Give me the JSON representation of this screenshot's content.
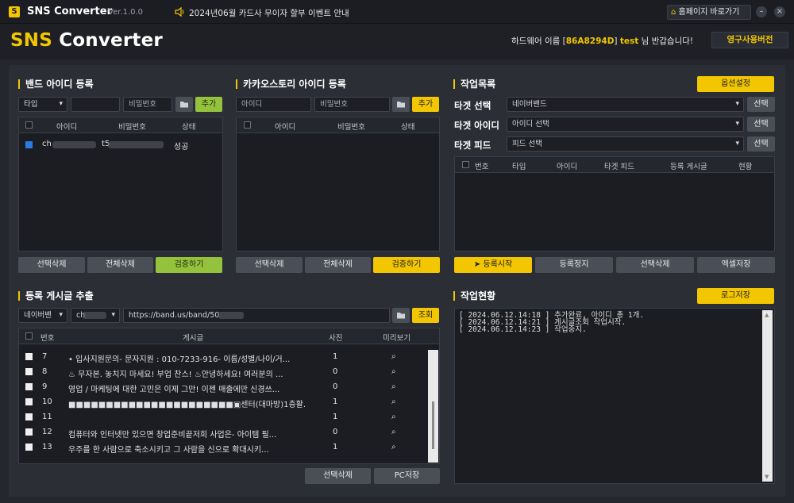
{
  "titlebar": {
    "logo_letter": "S",
    "app_name": "SNS Converter",
    "version": "Ver.1.0.0",
    "notice": "2024년06월 카드사 무이자 할부 이벤트 안내",
    "home_button": "홈페이지 바로가기",
    "minimize": "–",
    "close": "×"
  },
  "header": {
    "logo_sns": "SNS",
    "logo_converter": "Converter",
    "hw_prefix": "하드웨어 이름 [",
    "hw_id": "86A8294D",
    "hw_mid": "] ",
    "user": "test",
    "hw_suffix": " 님 반갑습니다!",
    "license_button": "영구사용버전"
  },
  "band": {
    "title": "밴드 아이디 등록",
    "type_select": "타입",
    "id_placeholder": "",
    "pw_placeholder": "비밀번호",
    "add_button": "추가",
    "columns": [
      "아이디",
      "비밀번호",
      "상태"
    ],
    "rows": [
      {
        "id": "ch",
        "pw": "t5",
        "status": "성공"
      }
    ],
    "delete_selected": "선택삭제",
    "delete_all": "전체삭제",
    "verify": "검증하기"
  },
  "kakao": {
    "title": "카카오스토리 아이디 등록",
    "id_placeholder": "아이디",
    "pw_placeholder": "비밀번호",
    "add_button": "추가",
    "columns": [
      "아이디",
      "비밀번호",
      "상태"
    ],
    "delete_selected": "선택삭제",
    "delete_all": "전체삭제",
    "verify": "검증하기"
  },
  "jobs": {
    "title": "작업목록",
    "options_button": "옵션설정",
    "target_select_label": "타겟 선택",
    "target_select_value": "네이버밴드",
    "target_id_label": "타겟 아이디",
    "target_id_value": "아이디 선택",
    "target_feed_label": "타겟 피드",
    "target_feed_value": "피드 선택",
    "select_button": "선택",
    "columns": [
      "번호",
      "타입",
      "아이디",
      "타겟 피드",
      "등록 게시글",
      "현황"
    ],
    "start": "등록시작",
    "stop": "등록정지",
    "delete_selected": "선택삭제",
    "excel_save": "엑셀저장"
  },
  "extract": {
    "title": "등록 게시글 추출",
    "source_select": "네이버밴",
    "account_select": "ch",
    "url": "https://band.us/band/50",
    "search_button": "조회",
    "columns": [
      "번호",
      "게시글",
      "사진",
      "미리보기"
    ],
    "rows": [
      {
        "no": "7",
        "text": "• 입사지원문의- 문자지원 : 010-7233-916- 이름/성별/나이/거...",
        "photos": "1"
      },
      {
        "no": "8",
        "text": "♨ 무자본. 놓치지 마세요! 부업 찬스! ♨안녕하세요! 여러분의 ...",
        "photos": "0"
      },
      {
        "no": "9",
        "text": "영업 / 마케팅에 대한 고민은 이제 그만! 이젠 매출에만 신경쓰...",
        "photos": "0"
      },
      {
        "no": "10",
        "text": "■■■■■■■■■■■■■■■■■■■■■■▣센터(대마방)1층활...",
        "photos": "1"
      },
      {
        "no": "11",
        "text": "",
        "photos": "1"
      },
      {
        "no": "12",
        "text": "컴퓨터와 인터넷만 있으면 창업준비끝저희 사업은- 아이템 필...",
        "photos": "0"
      },
      {
        "no": "13",
        "text": "    우주를 한 사람으로 축소시키고 그 사람을 신으로 확대시키...",
        "photos": "1"
      }
    ],
    "delete_selected": "선택삭제",
    "pc_save": "PC저장"
  },
  "status": {
    "title": "작업현황",
    "log_save": "로그저장",
    "log_lines": [
      "[ 2024.06.12.14:18 ] 추가완료, 아이디 총 1개.",
      "[ 2024.06.12.14:21 ] 게시글조회 작업시작.",
      "[ 2024.06.12.14:23 ] 작업중지."
    ]
  },
  "colors": {
    "accent": "#f2c600",
    "verify": "#94c23d",
    "background": "#24272e"
  }
}
